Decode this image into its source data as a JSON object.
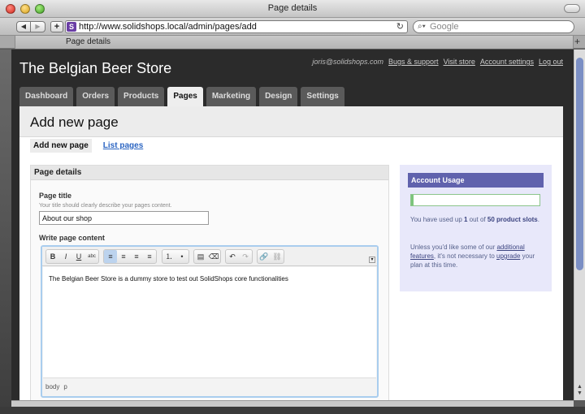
{
  "window": {
    "title": "Page details",
    "url": "http://www.solidshops.local/admin/pages/add",
    "search_placeholder": "Google",
    "tab_label": "Page details",
    "favicon_letter": "S"
  },
  "header": {
    "store_name": "The Belgian Beer Store",
    "user_email": "joris@solidshops.com",
    "links": [
      "Bugs & support",
      "Visit store",
      "Account settings",
      "Log out"
    ]
  },
  "main_tabs": [
    {
      "label": "Dashboard",
      "active": false
    },
    {
      "label": "Orders",
      "active": false
    },
    {
      "label": "Products",
      "active": false
    },
    {
      "label": "Pages",
      "active": true
    },
    {
      "label": "Marketing",
      "active": false
    },
    {
      "label": "Design",
      "active": false
    },
    {
      "label": "Settings",
      "active": false
    }
  ],
  "content": {
    "heading": "Add new page",
    "subtabs": {
      "add": "Add new page",
      "list": "List pages"
    }
  },
  "page_details": {
    "section_title": "Page details",
    "title_label": "Page title",
    "title_hint": "Your title should clearly describe your pages content.",
    "title_value": "About our shop",
    "content_label": "Write page content",
    "editor_text": "The Belgian Beer Store is a dummy store to test out SolidShops core functionalities",
    "editor_path": [
      "body",
      "p"
    ],
    "toolbar": {
      "bold": "B",
      "italic": "I",
      "underline": "U",
      "strike": "abc"
    }
  },
  "usage": {
    "title": "Account Usage",
    "used": 1,
    "total": 50,
    "fill_fraction": 0.02,
    "line1_pre": "You have used up ",
    "line1_used": "1",
    "line1_mid": " out of ",
    "line1_total": "50 product slots",
    "line1_post": ".",
    "line2_pre": "Unless you'd like some of our ",
    "line2_link1": "additional features",
    "line2_mid": ", it's not necessary to ",
    "line2_link2": "upgrade",
    "line2_post": " your plan at this time."
  },
  "colors": {
    "header_bg": "#2b2b2b",
    "usage_head": "#6062ad",
    "usage_bg": "#e8e8fa",
    "link": "#2a64c2",
    "editor_border": "#a9cdee"
  }
}
